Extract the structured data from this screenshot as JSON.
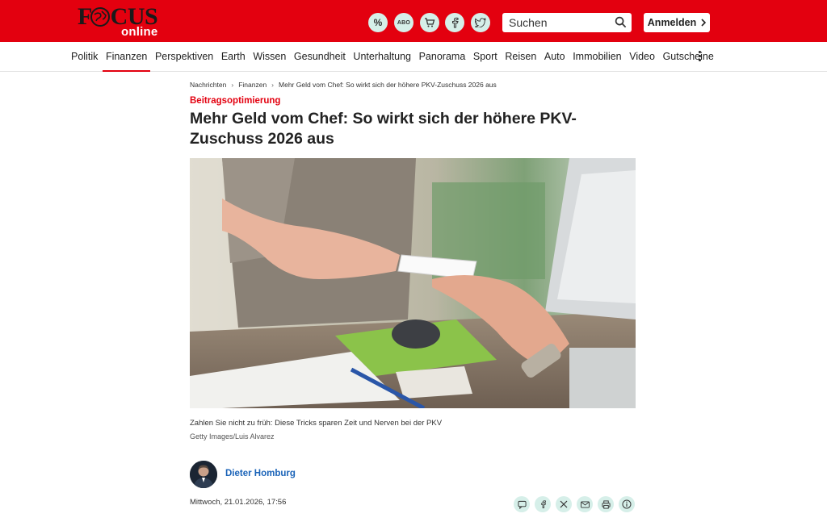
{
  "header": {
    "logo_main": "FOCUS",
    "logo_sub": "online",
    "icons": [
      "percent-icon",
      "abo-icon",
      "cart-icon",
      "facebook-icon",
      "twitter-icon"
    ],
    "abo_label": "ABO",
    "percent_label": "%",
    "search": {
      "placeholder": "Suchen"
    },
    "login_label": "Anmelden",
    "brand_color": "#e3000f",
    "icon_bg": "#d6efe9"
  },
  "nav": {
    "items": [
      "Politik",
      "Finanzen",
      "Perspektiven",
      "Earth",
      "Wissen",
      "Gesundheit",
      "Unterhaltung",
      "Panorama",
      "Sport",
      "Reisen",
      "Auto",
      "Immobilien",
      "Video",
      "Gutscheine"
    ],
    "active": "Finanzen"
  },
  "article": {
    "breadcrumb": [
      "Nachrichten",
      "Finanzen",
      "Mehr Geld vom Chef: So wirkt sich der höhere PKV-Zuschuss 2026 aus"
    ],
    "kicker": "Beitragsoptimierung",
    "headline": "Mehr Geld vom Chef: So wirkt sich der höhere PKV-Zuschuss 2026 aus",
    "image_caption": "Zahlen Sie nicht zu früh: Diese Tricks sparen Zeit und Nerven bei der PKV",
    "image_credit": "Getty Images/Luis Alvarez",
    "author": "Dieter Homburg",
    "date": "Mittwoch, 21.01.2026, 17:56",
    "share_icons": [
      "comment-icon",
      "facebook-icon",
      "x-icon",
      "mail-icon",
      "print-icon",
      "info-icon"
    ],
    "author_color": "#1a63b8"
  }
}
